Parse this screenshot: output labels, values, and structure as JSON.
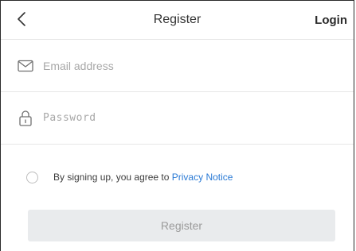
{
  "header": {
    "back_icon": "chevron-left-icon",
    "title": "Register",
    "login_label": "Login"
  },
  "form": {
    "email": {
      "icon": "envelope-icon",
      "placeholder": "Email address",
      "value": ""
    },
    "password": {
      "icon": "lock-icon",
      "placeholder": "Password",
      "value": ""
    },
    "agreement": {
      "checked": false,
      "text": "By signing up, you agree to ",
      "link_text": "Privacy Notice"
    },
    "submit_label": "Register"
  },
  "colors": {
    "link": "#2a7ad5",
    "button_bg_disabled": "#e9ebed",
    "button_text_disabled": "#9a9a9a",
    "placeholder": "#a8a8a8"
  }
}
